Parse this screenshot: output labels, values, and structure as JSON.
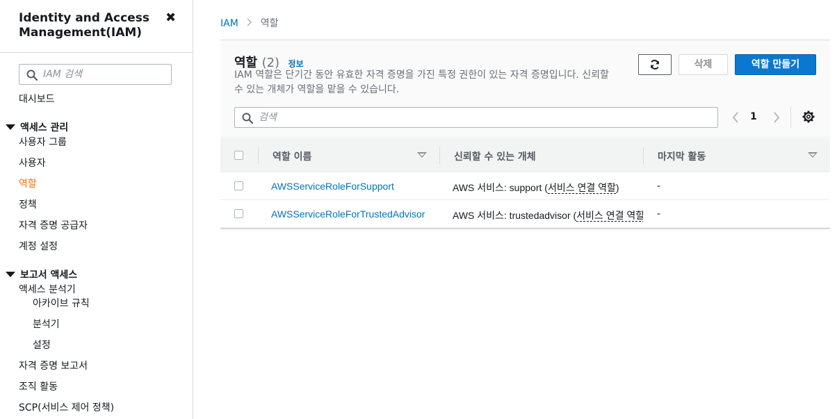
{
  "sidebar": {
    "title": "Identity and Access Management(IAM)",
    "search_placeholder": "IAM 검색",
    "dashboard": "대시보드",
    "access_management": {
      "label": "액세스 관리",
      "items": [
        "사용자 그룹",
        "사용자",
        "역할",
        "정책",
        "자격 증명 공급자",
        "계정 설정"
      ]
    },
    "access_reports": {
      "label": "보고서 액세스",
      "analyzer": "액세스 분석기",
      "sub_items": [
        "아카이브 규칙",
        "분석기",
        "설정"
      ],
      "items": [
        "자격 증명 보고서",
        "조직 활동",
        "SCP(서비스 제어 정책)"
      ]
    }
  },
  "breadcrumb": {
    "root": "IAM",
    "current": "역할"
  },
  "panel": {
    "title": "역할",
    "count": "(2)",
    "info": "정보",
    "description": "IAM 역할은 단기간 동안 유효한 자격 증명을 가진 특정 권한이 있는 자격 증명입니다. 신뢰할 수 있는 개체가 역할을 맡을 수 있습니다.",
    "delete_label": "삭제",
    "create_label": "역할 만들기",
    "search_placeholder": "검색",
    "page": "1"
  },
  "table": {
    "columns": [
      "역할 이름",
      "신뢰할 수 있는 개체",
      "마지막 활동"
    ],
    "rows": [
      {
        "name": "AWSServiceRoleForSupport",
        "trusted_prefix": "AWS 서비스: support (",
        "trusted_link": "서비스 연결 역할",
        "trusted_suffix": ")",
        "last": "-"
      },
      {
        "name": "AWSServiceRoleForTrustedAdvisor",
        "trusted_prefix": "AWS 서비스: trustedadvisor (",
        "trusted_link": "서비스 연결 역할",
        "trusted_suffix": ")",
        "last": "-"
      }
    ]
  },
  "colors": {
    "link": "#0073bb",
    "active_nav": "#ec7211",
    "primary_button": "#0a78d1"
  },
  "icons": [
    "close-icon",
    "search-icon",
    "refresh-icon",
    "chevron-left-icon",
    "chevron-right-icon",
    "gear-icon",
    "caret-down-icon",
    "sort-icon"
  ]
}
